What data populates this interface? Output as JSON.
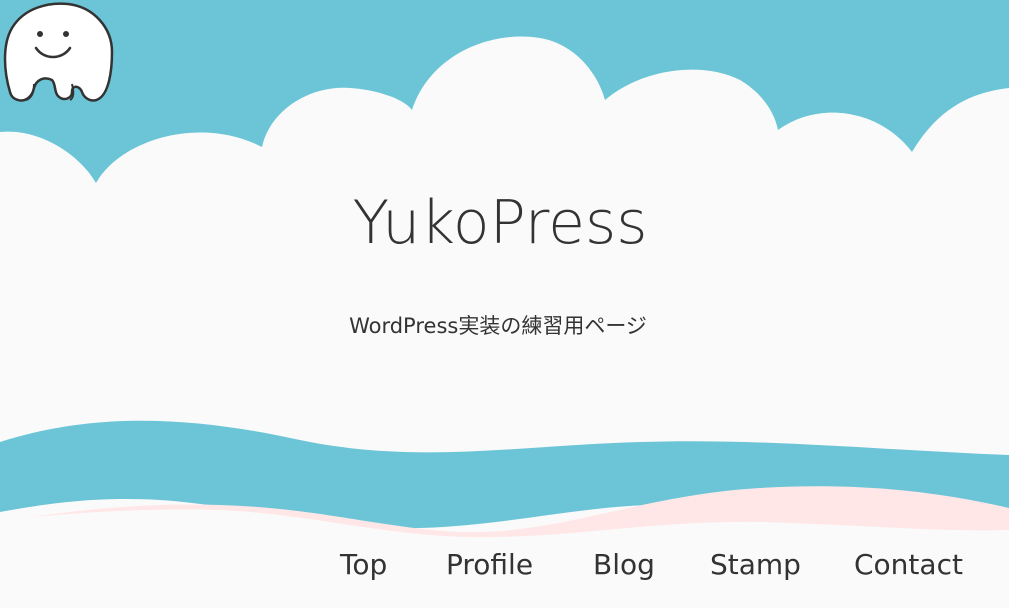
{
  "site": {
    "title": "YukoPress",
    "tagline": "WordPress実装の練習用ページ"
  },
  "nav": {
    "items": [
      {
        "label": "Top",
        "active": true
      },
      {
        "label": "Profile",
        "active": false
      },
      {
        "label": "Blog",
        "active": false
      },
      {
        "label": "Stamp",
        "active": false
      },
      {
        "label": "Contact",
        "active": false
      }
    ]
  },
  "colors": {
    "sky": "#6cc5d6",
    "cloud": "#fbfafa",
    "wave_pink": "#ffe7e8",
    "text": "#333333"
  },
  "icons": {
    "mascot": "smiling-ghost-mascot"
  }
}
